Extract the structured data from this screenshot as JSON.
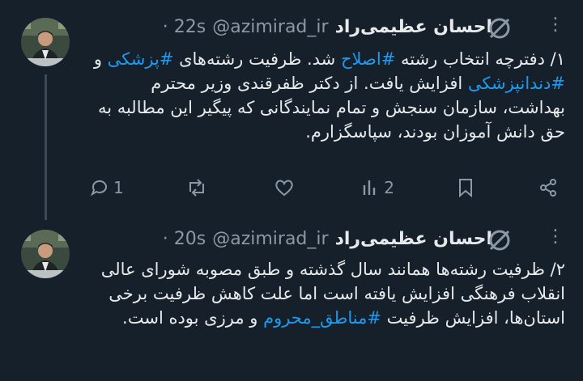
{
  "tweets": [
    {
      "display_name": "احسان عظیمی‌راد",
      "handle": "@azimirad_ir",
      "time": "· 22s",
      "body": [
        {
          "text": "۱/ دفترچه انتخاب رشته "
        },
        {
          "text": "#اصلاح",
          "tag": true
        },
        {
          "text": " شد. ظرفیت رشته‌های "
        },
        {
          "text": "#پزشکی",
          "tag": true
        },
        {
          "text": " و "
        },
        {
          "text": "#دندانپزشکی",
          "tag": true
        },
        {
          "text": " افزایش یافت. از دکتر ظفرقندی وزیر محترم بهداشت، سازمان سنجش و تمام نمایندگانی که پیگیر این مطالبه به حق دانش آموزان بودند، سپاسگزارم."
        }
      ],
      "actions": {
        "replies": "1",
        "reposts": "",
        "likes": "",
        "views": "2"
      }
    },
    {
      "display_name": "احسان عظیمی‌راد",
      "handle": "@azimirad_ir",
      "time": "· 20s",
      "body": [
        {
          "text": "۲/ ظرفیت رشته‌ها همانند سال گذشته و طبق مصوبه شورای عالی انقلاب فرهنگی افزایش یافته است اما علت کاهش ظرفیت برخی استان‌ها، افزایش ظرفیت "
        },
        {
          "text": "#مناطق_محروم",
          "tag": true
        },
        {
          "text": " و مرزی بوده است."
        }
      ]
    }
  ],
  "colors": {
    "background": "#15202b",
    "text": "#e7e9ea",
    "muted": "#8b98a5",
    "link": "#1d9bf0"
  }
}
